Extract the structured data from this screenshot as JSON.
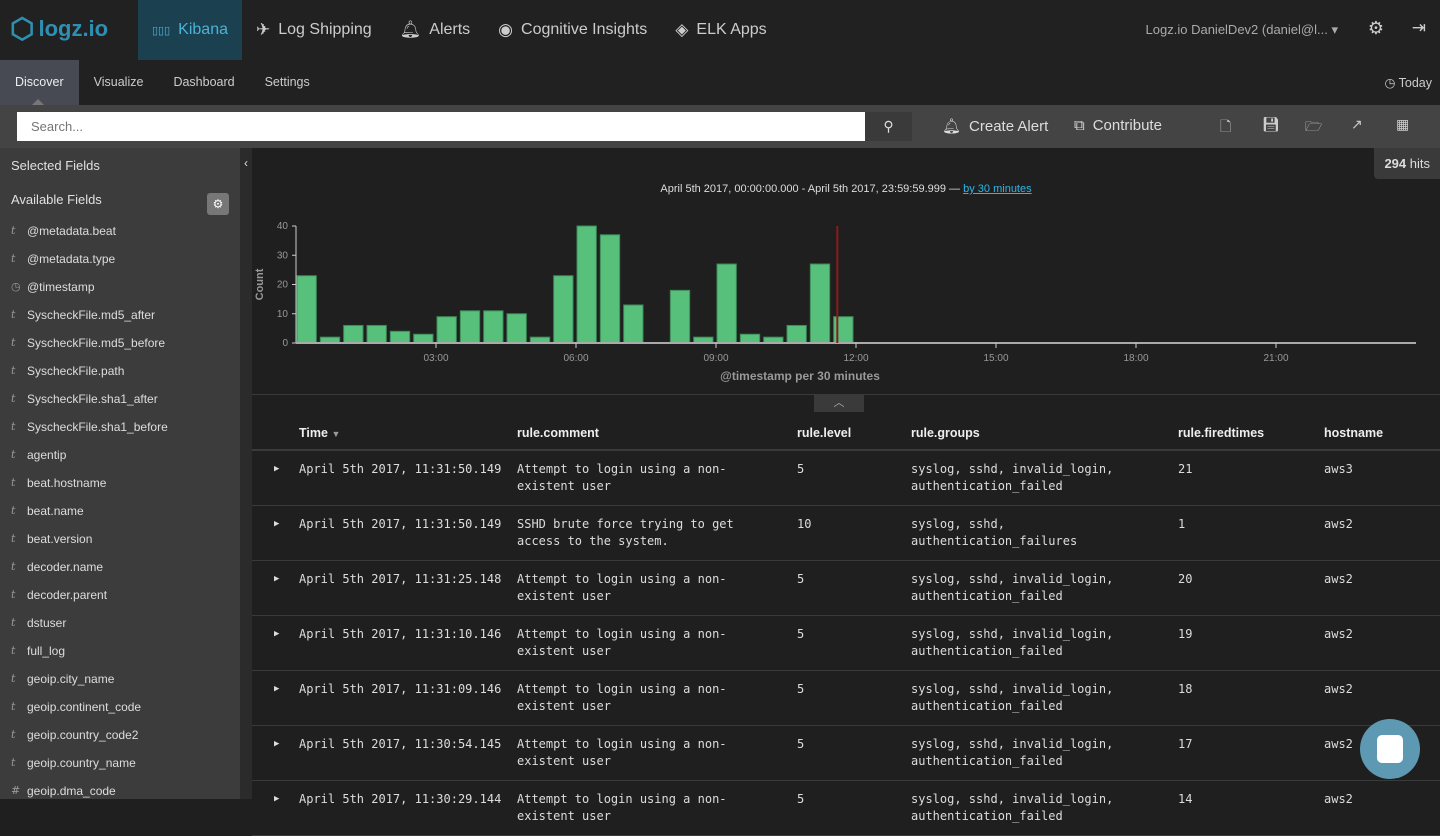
{
  "brand": {
    "name": "logz.io"
  },
  "nav": [
    {
      "label": "Kibana",
      "icon": "bar-chart-icon",
      "active": true
    },
    {
      "label": "Log Shipping",
      "icon": "paper-plane-icon"
    },
    {
      "label": "Alerts",
      "icon": "bell-icon"
    },
    {
      "label": "Cognitive Insights",
      "icon": "eye-icon"
    },
    {
      "label": "ELK Apps",
      "icon": "layers-icon"
    }
  ],
  "user": "Logz.io DanielDev2 (daniel@l...",
  "subnav": [
    "Discover",
    "Visualize",
    "Dashboard",
    "Settings"
  ],
  "time_picker": "Today",
  "search": {
    "placeholder": "Search..."
  },
  "toolbar": {
    "create_alert": "Create Alert",
    "contribute": "Contribute"
  },
  "sidebar": {
    "selected_title": "Selected Fields",
    "available_title": "Available Fields",
    "fields": [
      {
        "type": "t",
        "name": "@metadata.beat"
      },
      {
        "type": "t",
        "name": "@metadata.type"
      },
      {
        "type": "clock",
        "name": "@timestamp"
      },
      {
        "type": "t",
        "name": "SyscheckFile.md5_after"
      },
      {
        "type": "t",
        "name": "SyscheckFile.md5_before"
      },
      {
        "type": "t",
        "name": "SyscheckFile.path"
      },
      {
        "type": "t",
        "name": "SyscheckFile.sha1_after"
      },
      {
        "type": "t",
        "name": "SyscheckFile.sha1_before"
      },
      {
        "type": "t",
        "name": "agentip"
      },
      {
        "type": "t",
        "name": "beat.hostname"
      },
      {
        "type": "t",
        "name": "beat.name"
      },
      {
        "type": "t",
        "name": "beat.version"
      },
      {
        "type": "t",
        "name": "decoder.name"
      },
      {
        "type": "t",
        "name": "decoder.parent"
      },
      {
        "type": "t",
        "name": "dstuser"
      },
      {
        "type": "t",
        "name": "full_log"
      },
      {
        "type": "t",
        "name": "geoip.city_name"
      },
      {
        "type": "t",
        "name": "geoip.continent_code"
      },
      {
        "type": "t",
        "name": "geoip.country_code2"
      },
      {
        "type": "t",
        "name": "geoip.country_name"
      },
      {
        "type": "#",
        "name": "geoip.dma_code"
      }
    ]
  },
  "hits": {
    "count": "294",
    "label": "hits"
  },
  "range": {
    "text": "April 5th 2017, 00:00:00.000 - April 5th 2017, 23:59:59.999 —",
    "interval": "by 30 minutes"
  },
  "chart_data": {
    "type": "bar",
    "xlabel": "@timestamp per 30 minutes",
    "ylabel": "Count",
    "ylim": [
      0,
      40
    ],
    "yticks": [
      0,
      10,
      20,
      30,
      40
    ],
    "xticks": [
      "03:00",
      "06:00",
      "09:00",
      "12:00",
      "15:00",
      "18:00",
      "21:00"
    ],
    "x": [
      "00:00",
      "00:30",
      "01:00",
      "01:30",
      "02:00",
      "02:30",
      "03:00",
      "03:30",
      "04:00",
      "04:30",
      "05:00",
      "05:30",
      "06:00",
      "06:30",
      "07:00",
      "07:30",
      "08:00",
      "08:30",
      "09:00",
      "09:30",
      "10:00",
      "10:30",
      "11:00",
      "11:30"
    ],
    "values": [
      23,
      2,
      6,
      6,
      4,
      3,
      9,
      11,
      11,
      10,
      2,
      23,
      40,
      37,
      13,
      0,
      18,
      2,
      27,
      3,
      2,
      6,
      27,
      9
    ],
    "bar_color": "#57c17b",
    "marker_color": "#8b1a1a"
  },
  "table": {
    "columns": [
      "Time",
      "rule.comment",
      "rule.level",
      "rule.groups",
      "rule.firedtimes",
      "hostname"
    ],
    "rows": [
      [
        "April 5th 2017, 11:31:50.149",
        "Attempt to login using a non-\nexistent user",
        "5",
        "syslog, sshd, invalid_login,\nauthentication_failed",
        "21",
        "aws3"
      ],
      [
        "April 5th 2017, 11:31:50.149",
        "SSHD brute force trying to get\naccess to the system.",
        "10",
        "syslog, sshd,\nauthentication_failures",
        "1",
        "aws2"
      ],
      [
        "April 5th 2017, 11:31:25.148",
        "Attempt to login using a non-\nexistent user",
        "5",
        "syslog, sshd, invalid_login,\nauthentication_failed",
        "20",
        "aws2"
      ],
      [
        "April 5th 2017, 11:31:10.146",
        "Attempt to login using a non-\nexistent user",
        "5",
        "syslog, sshd, invalid_login,\nauthentication_failed",
        "19",
        "aws2"
      ],
      [
        "April 5th 2017, 11:31:09.146",
        "Attempt to login using a non-\nexistent user",
        "5",
        "syslog, sshd, invalid_login,\nauthentication_failed",
        "18",
        "aws2"
      ],
      [
        "April 5th 2017, 11:30:54.145",
        "Attempt to login using a non-\nexistent user",
        "5",
        "syslog, sshd, invalid_login,\nauthentication_failed",
        "17",
        "aws2"
      ],
      [
        "April 5th 2017, 11:30:29.144",
        "Attempt to login using a non-\nexistent user",
        "5",
        "syslog, sshd, invalid_login,\nauthentication_failed",
        "14",
        "aws2"
      ]
    ]
  }
}
